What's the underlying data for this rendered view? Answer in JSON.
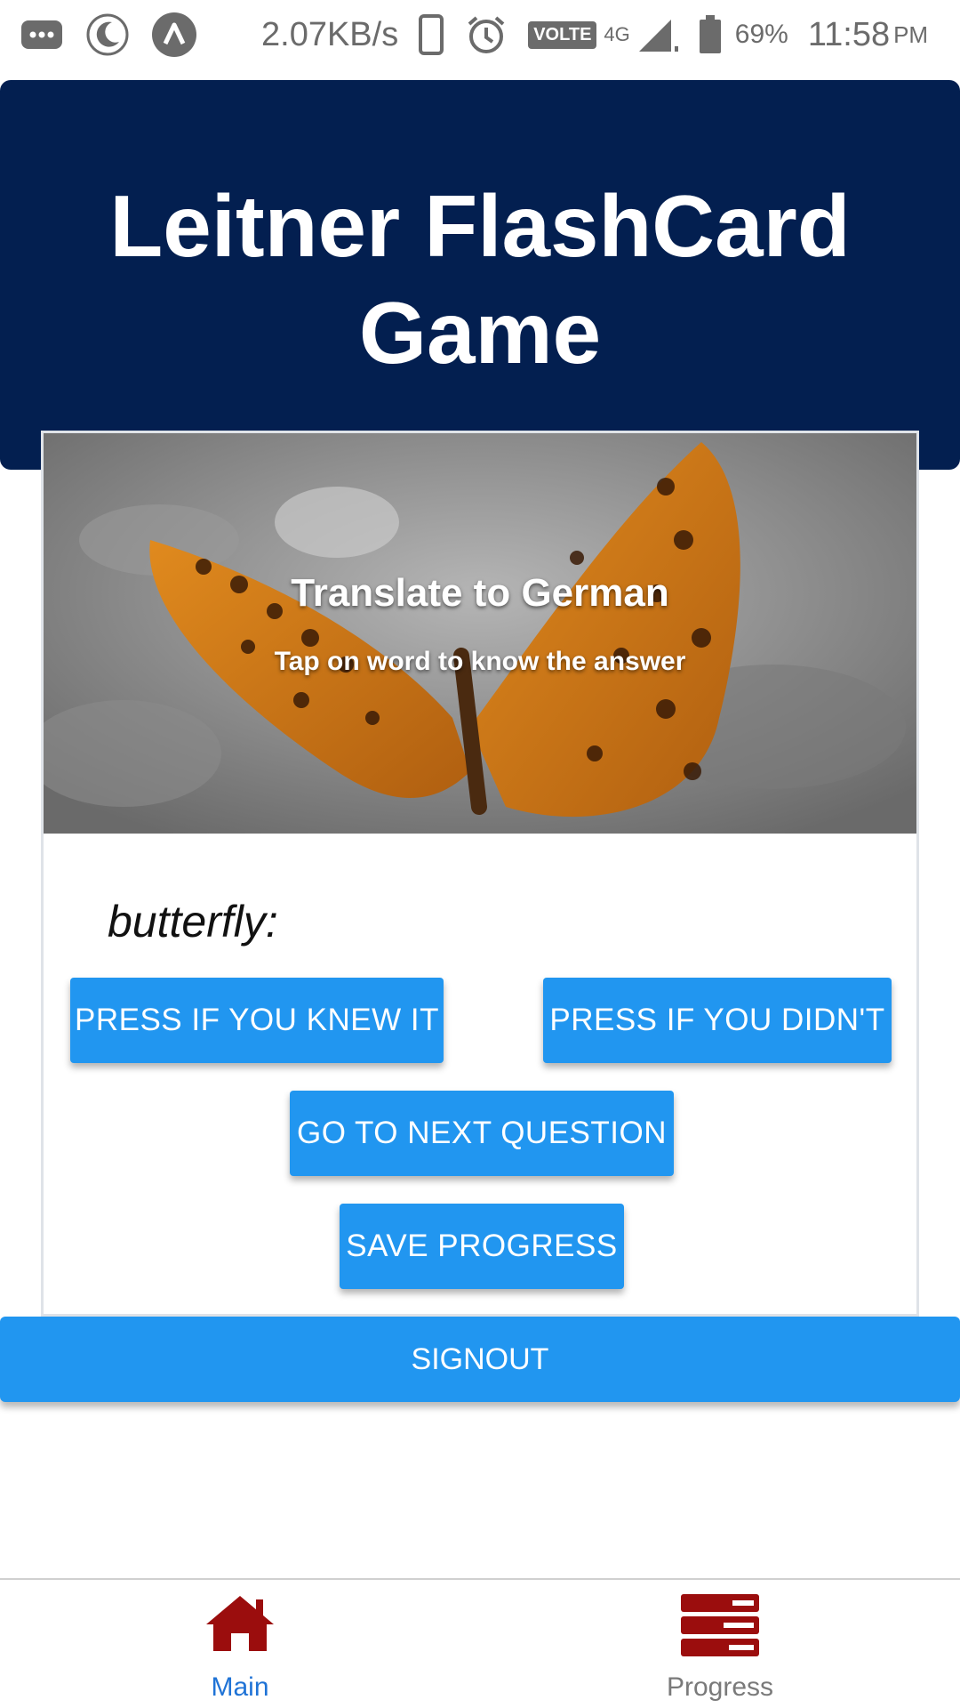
{
  "status_bar": {
    "network_speed": "2.07KB/s",
    "volte_label": "VOLTE",
    "network_type": "4G",
    "battery_percent": "69%",
    "time": "11:58",
    "time_period": "PM",
    "icons": [
      "message-icon",
      "night-mode-icon",
      "app-icon",
      "phone-icon",
      "alarm-icon",
      "signal-icon",
      "battery-icon"
    ]
  },
  "header": {
    "title": "Leitner FlashCard Game",
    "background_color": "#031f50"
  },
  "card": {
    "image_title": "Translate to German",
    "image_subtitle": "Tap on word to know the answer",
    "word": "butterfly:"
  },
  "buttons": {
    "knew": "PRESS IF YOU KNEW IT",
    "didnt": "PRESS IF YOU DIDN'T",
    "next": "GO TO NEXT QUESTION",
    "save": "SAVE PROGRESS",
    "signout": "SIGNOUT",
    "accent_color": "#2196f0"
  },
  "bottom_nav": {
    "items": [
      {
        "label": "Main",
        "icon": "home-icon",
        "active": true
      },
      {
        "label": "Progress",
        "icon": "progress-icon",
        "active": false
      }
    ],
    "active_color": "#1f73d6",
    "icon_color": "#9b0d0d"
  }
}
